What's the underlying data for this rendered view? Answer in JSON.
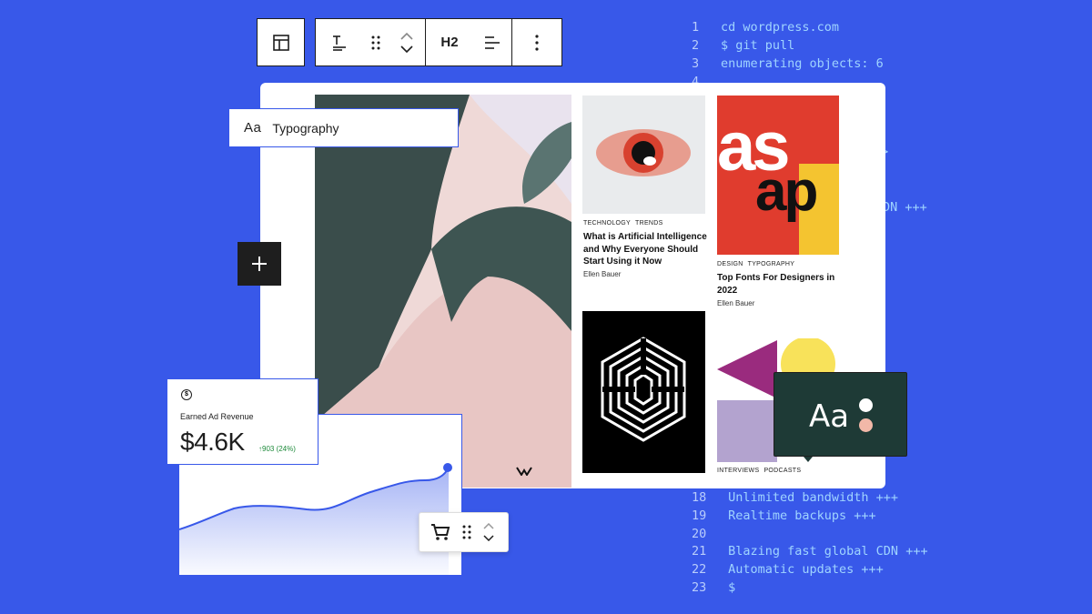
{
  "toolbar": {
    "heading_label": "H2"
  },
  "typography_field": {
    "aa": "Aa",
    "label": "Typography"
  },
  "code_lines": [
    {
      "n": "1",
      "t": "cd wordpress.com"
    },
    {
      "n": "2",
      "t": "$ git pull"
    },
    {
      "n": "3",
      "t": "enumerating objects: 6"
    },
    {
      "n": "4",
      "t": ""
    },
    {
      "n": "18",
      "t": " Unlimited bandwidth +++"
    },
    {
      "n": "19",
      "t": " Realtime backups +++"
    },
    {
      "n": "20",
      "t": ""
    },
    {
      "n": "21",
      "t": " Blazing fast global CDN +++"
    },
    {
      "n": "22",
      "t": " Automatic updates +++"
    },
    {
      "n": "23",
      "t": " $"
    }
  ],
  "code_fragments": {
    "cdn": "DN +++",
    "arrow": ">"
  },
  "posts": {
    "ai": {
      "tags": [
        "TECHNOLOGY",
        "TRENDS"
      ],
      "title": "What is Artificial Intelligence and Why Everyone Should Start Using it Now",
      "author": "Ellen Bauer"
    },
    "fonts": {
      "tags": [
        "DESIGN",
        "TYPOGRAPHY"
      ],
      "title": "Top Fonts For Designers in 2022",
      "author": "Ellen Bauer"
    },
    "podcasts": {
      "tags": [
        "INTERVIEWS",
        "PODCASTS"
      ]
    }
  },
  "asap": {
    "line1": "as",
    "line2": "ap"
  },
  "revenue": {
    "title": "Earned Ad Revenue",
    "value": "$4.6K",
    "delta": "↑903 (24%)"
  },
  "font_preview": {
    "aa": "Aa"
  },
  "colors": {
    "background": "#3858e9",
    "code": "#9fd4ff",
    "chart_line": "#3858e9",
    "positive": "#1d8a3a"
  }
}
